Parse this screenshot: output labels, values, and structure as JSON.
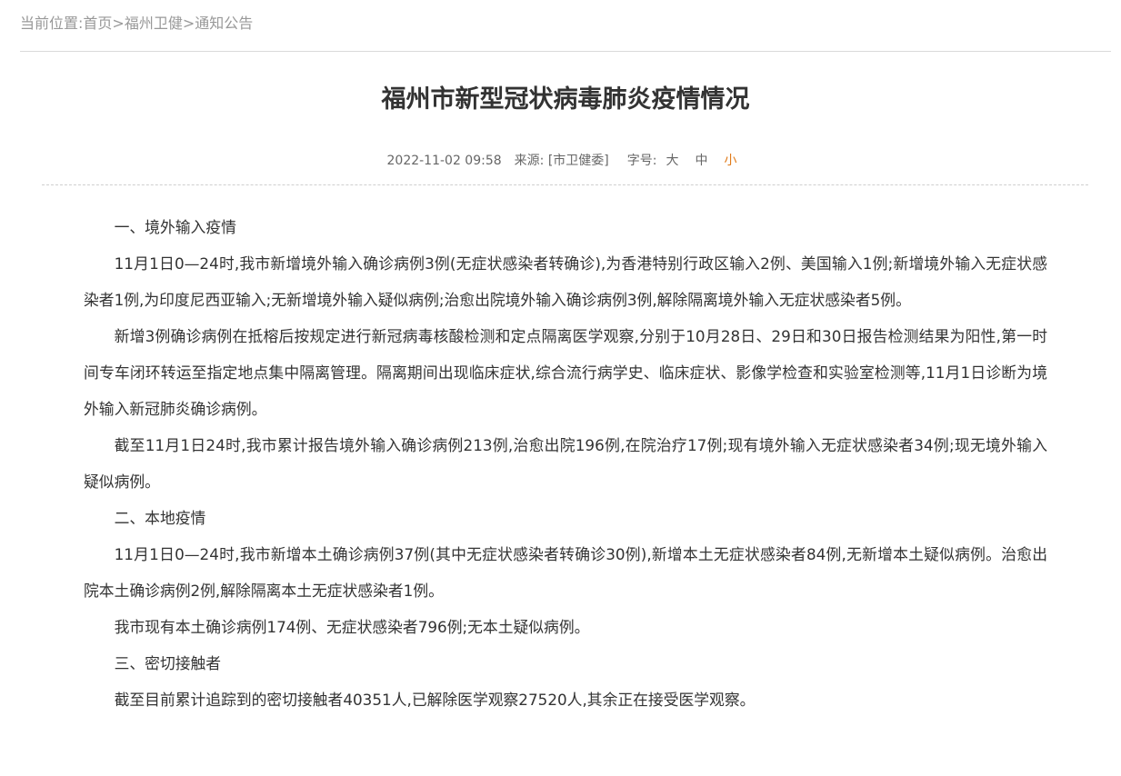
{
  "breadcrumb": {
    "prefix": "当前位置:",
    "items": [
      "首页",
      "福州卫健",
      "通知公告"
    ],
    "separator": ">"
  },
  "article": {
    "title": "福州市新型冠状病毒肺炎疫情情况",
    "date": "2022-11-02 09:58",
    "source": "来源: [市卫健委]",
    "font_size_label": "字号:",
    "font_sizes": [
      "大",
      "中",
      "小"
    ],
    "paragraphs": [
      "一、境外输入疫情",
      "11月1日0—24时,我市新增境外输入确诊病例3例(无症状感染者转确诊),为香港特别行政区输入2例、美国输入1例;新增境外输入无症状感染者1例,为印度尼西亚输入;无新增境外输入疑似病例;治愈出院境外输入确诊病例3例,解除隔离境外输入无症状感染者5例。",
      "新增3例确诊病例在抵榕后按规定进行新冠病毒核酸检测和定点隔离医学观察,分别于10月28日、29日和30日报告检测结果为阳性,第一时间专车闭环转运至指定地点集中隔离管理。隔离期间出现临床症状,综合流行病学史、临床症状、影像学检查和实验室检测等,11月1日诊断为境外输入新冠肺炎确诊病例。",
      "截至11月1日24时,我市累计报告境外输入确诊病例213例,治愈出院196例,在院治疗17例;现有境外输入无症状感染者34例;现无境外输入疑似病例。",
      "二、本地疫情",
      "11月1日0—24时,我市新增本土确诊病例37例(其中无症状感染者转确诊30例),新增本土无症状感染者84例,无新增本土疑似病例。治愈出院本土确诊病例2例,解除隔离本土无症状感染者1例。",
      "我市现有本土确诊病例174例、无症状感染者796例;无本土疑似病例。",
      "三、密切接触者",
      "截至目前累计追踪到的密切接触者40351人,已解除医学观察27520人,其余正在接受医学观察。"
    ]
  },
  "colors": {
    "active_font_size": "#e07b1a",
    "breadcrumb": "#999999",
    "body_text": "#333333"
  }
}
